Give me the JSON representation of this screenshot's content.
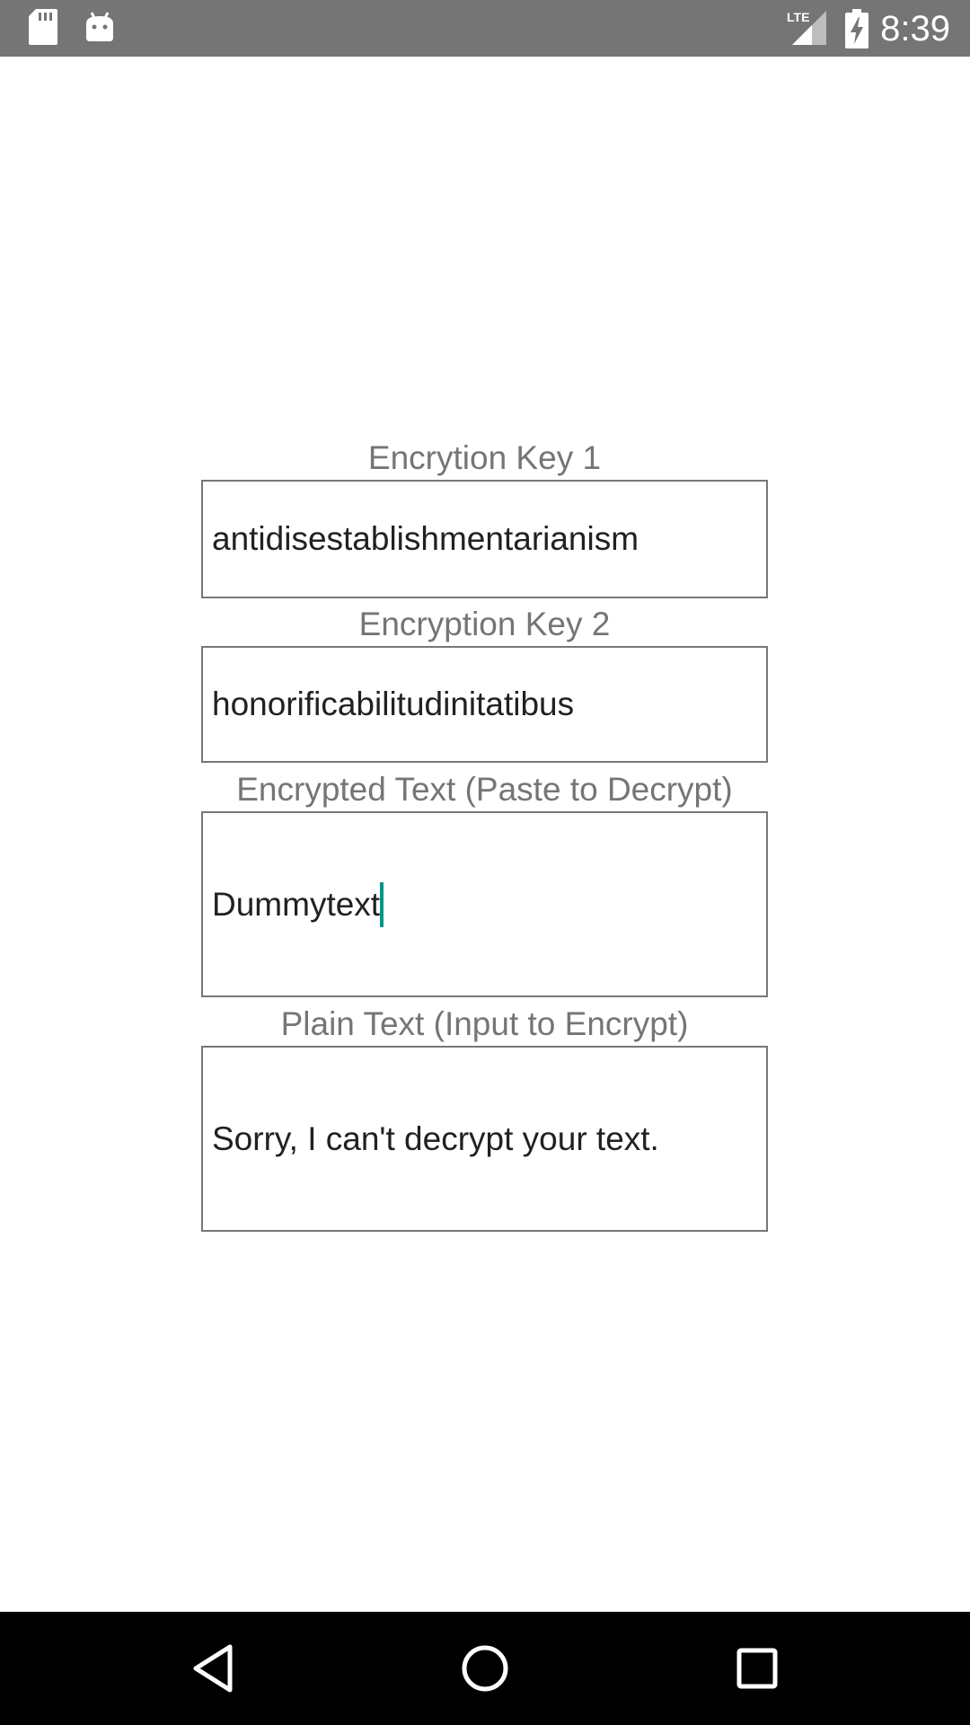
{
  "status_bar": {
    "time": "8:39",
    "network": "LTE",
    "icons": [
      "sd-card-icon",
      "android-icon",
      "signal-icon",
      "battery-charging-icon"
    ]
  },
  "form": {
    "key1": {
      "label": "Encrytion Key 1",
      "value": "antidisestablishmentarianism"
    },
    "key2": {
      "label": "Encryption Key 2",
      "value": "honorificabilitudinitatibus"
    },
    "encrypted": {
      "label": "Encrypted Text (Paste to Decrypt)",
      "value": "Dummytext"
    },
    "plain": {
      "label": "Plain Text (Input to Encrypt)",
      "value": "Sorry, I can't decrypt your text."
    }
  },
  "nav_bar": {
    "icons": [
      "back-icon",
      "home-icon",
      "recents-icon"
    ]
  },
  "colors": {
    "status_bar": "#757575",
    "label": "#757575",
    "border": "#777777",
    "cursor": "#009688",
    "nav_bar": "#000000"
  }
}
